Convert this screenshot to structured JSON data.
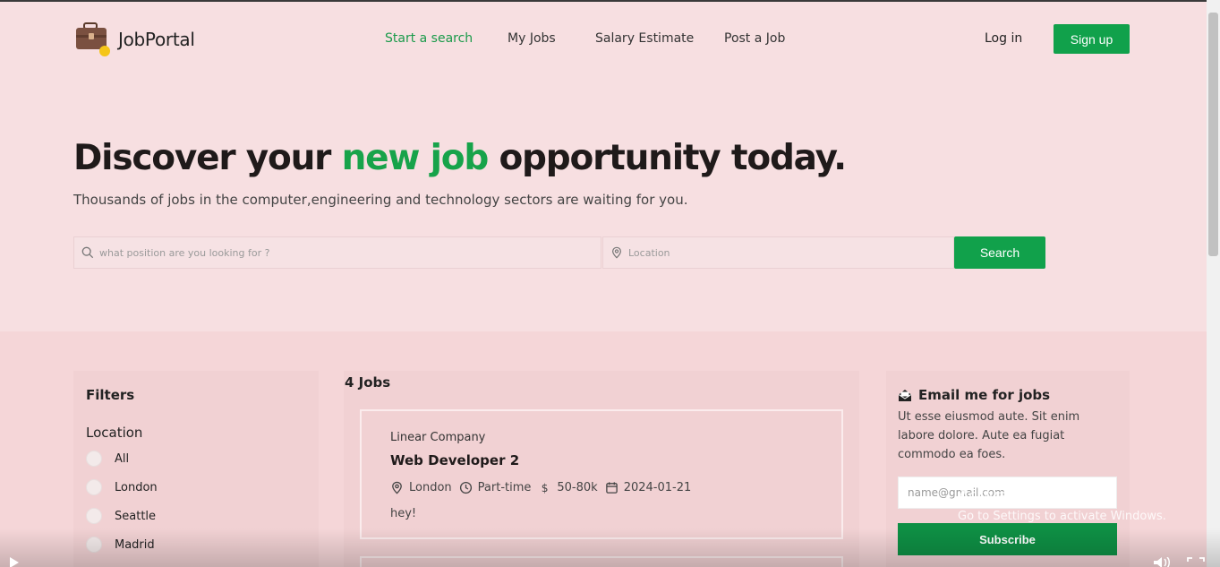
{
  "brand": {
    "name": "JobPortal",
    "accent": "#17a34a",
    "button_color": "#11a14b"
  },
  "nav": {
    "items": [
      {
        "label": "Start a search",
        "active": true
      },
      {
        "label": "My Jobs",
        "active": false
      },
      {
        "label": "Salary Estimate",
        "active": false
      },
      {
        "label": "Post a Job",
        "active": false
      }
    ],
    "login_label": "Log in",
    "signup_label": "Sign up"
  },
  "hero": {
    "title_before": "Discover your",
    "title_accent": "new job",
    "title_after": "opportunity today.",
    "subtitle": "Thousands of jobs in the computer,engineering and technology sectors are waiting for you."
  },
  "search": {
    "position_placeholder": "what position are you looking for ?",
    "location_placeholder": "Location",
    "button_label": "Search"
  },
  "filters": {
    "title": "Filters",
    "location_title": "Location",
    "options": [
      "All",
      "London",
      "Seattle",
      "Madrid"
    ]
  },
  "jobs": {
    "count_label": "4 Jobs",
    "items": [
      {
        "company": "Linear Company",
        "title": "Web Developer 2",
        "location": "London",
        "type": "Part-time",
        "salary": "50-80k",
        "date": "2024-01-21",
        "description": "hey!"
      }
    ]
  },
  "email_panel": {
    "title": "Email me for jobs",
    "text": "Ut esse eiusmod aute. Sit enim labore dolore. Aute ea fugiat commodo ea foes.",
    "input_placeholder": "name@gmail.com",
    "button_label": "Subscribe"
  },
  "watermark": {
    "line1": "Activate Windows",
    "line2": "Go to Settings to activate Windows."
  }
}
